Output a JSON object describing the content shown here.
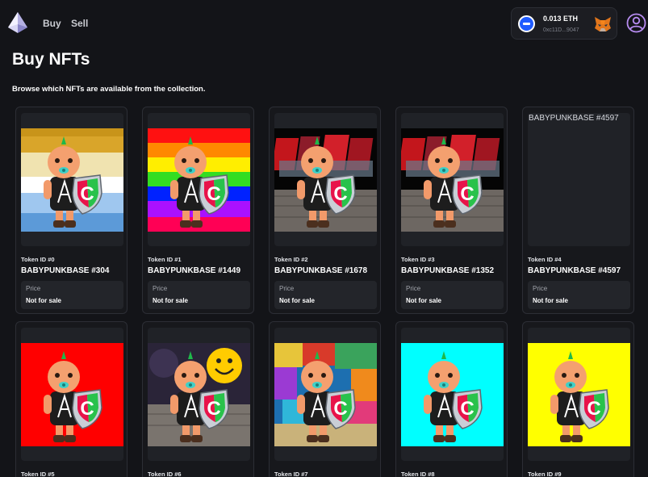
{
  "nav": {
    "buy_label": "Buy",
    "sell_label": "Sell"
  },
  "wallet": {
    "balance": "0.013 ETH",
    "address": "0xc11D...9047"
  },
  "header": {
    "title": "Buy NFTs",
    "subtitle": "Browse which NFTs are available from the collection."
  },
  "price_label": "Price",
  "nfts": [
    {
      "token_id": "Token ID #0",
      "name": "BABYPUNKBASE #304",
      "price": "Not for sale",
      "bg": "gold"
    },
    {
      "token_id": "Token ID #1",
      "name": "BABYPUNKBASE #1449",
      "price": "Not for sale",
      "bg": "rainbow"
    },
    {
      "token_id": "Token ID #2",
      "name": "BABYPUNKBASE #1678",
      "price": "Not for sale",
      "bg": "graffiti"
    },
    {
      "token_id": "Token ID #3",
      "name": "BABYPUNKBASE #1352",
      "price": "Not for sale",
      "bg": "graffiti"
    },
    {
      "token_id": "Token ID #4",
      "name": "BABYPUNKBASE #4597",
      "price": "Not for sale",
      "bg": "broken",
      "alt": "BABYPUNKBASE #4597"
    },
    {
      "token_id": "Token ID #5",
      "name": "",
      "price": "",
      "bg": "red"
    },
    {
      "token_id": "Token ID #6",
      "name": "",
      "price": "",
      "bg": "smiley"
    },
    {
      "token_id": "Token ID #7",
      "name": "",
      "price": "",
      "bg": "wall"
    },
    {
      "token_id": "Token ID #8",
      "name": "",
      "price": "",
      "bg": "cyan"
    },
    {
      "token_id": "Token ID #9",
      "name": "",
      "price": "",
      "bg": "yellow"
    }
  ]
}
